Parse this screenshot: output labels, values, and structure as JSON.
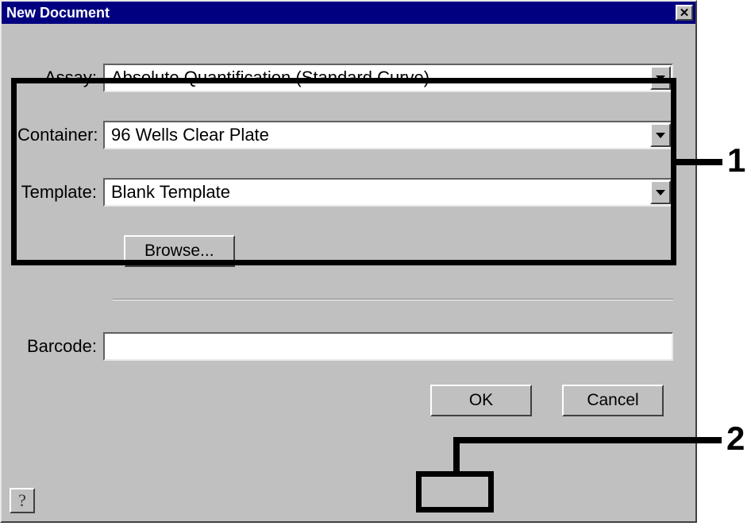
{
  "title": "New Document",
  "labels": {
    "assay": "Assay:",
    "container": "Container:",
    "template": "Template:",
    "barcode": "Barcode:"
  },
  "values": {
    "assay": "Absolute Quantification (Standard Curve)",
    "container": "96 Wells Clear Plate",
    "template": "Blank Template",
    "barcode": ""
  },
  "buttons": {
    "browse": "Browse...",
    "ok": "OK",
    "cancel": "Cancel",
    "help": "?"
  },
  "annotations": {
    "callout1": "1",
    "callout2": "2"
  }
}
